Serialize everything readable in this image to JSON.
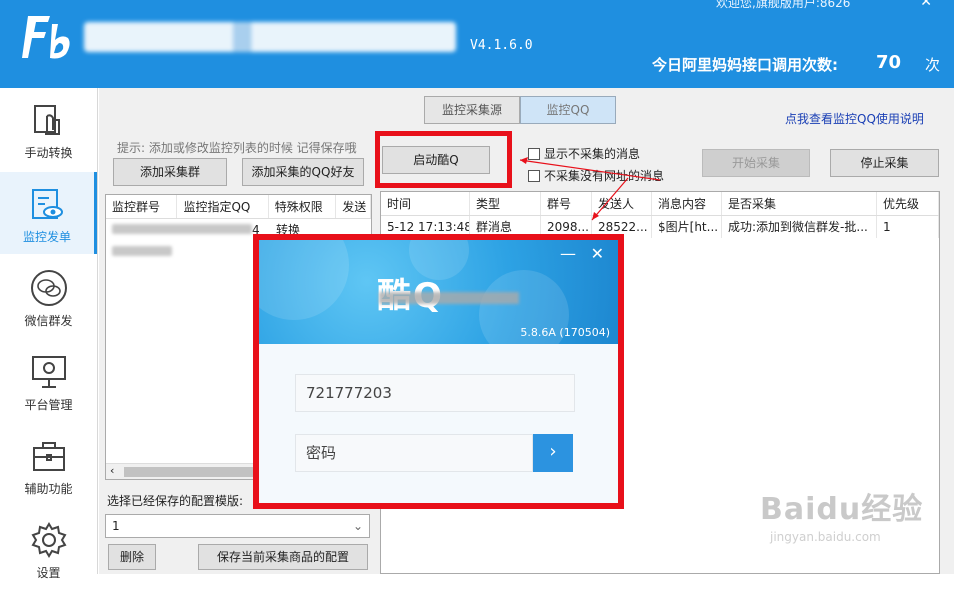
{
  "header": {
    "welcome": "欢迎您,旗舰版用户:8626",
    "close": "✕",
    "version": "V4.1.6.0",
    "api_label": "今日阿里妈妈接口调用次数:",
    "api_count": "70",
    "api_unit": "次"
  },
  "sidebar": {
    "items": [
      {
        "label": "手动转换",
        "icon": "hand-convert-icon"
      },
      {
        "label": "监控发单",
        "icon": "monitor-icon"
      },
      {
        "label": "微信群发",
        "icon": "wechat-icon"
      },
      {
        "label": "平台管理",
        "icon": "platform-icon"
      },
      {
        "label": "辅助功能",
        "icon": "toolbox-icon"
      },
      {
        "label": "设置",
        "icon": "gear-icon"
      }
    ]
  },
  "tabs": [
    "监控采集源",
    "监控QQ"
  ],
  "help_link": "点我查看监控QQ使用说明",
  "left_panel": {
    "hint": "提示: 添加或修改监控列表的时候 记得保存哦",
    "add_group_btn": "添加采集群",
    "add_friend_btn": "添加采集的QQ好友",
    "columns": [
      "监控群号",
      "监控指定QQ",
      "特殊权限",
      "发送"
    ],
    "rows": [
      {
        "col3": "转换",
        "tail": "4"
      }
    ],
    "save_label": "选择已经保存的配置模版:",
    "selected_template": "1",
    "delete_btn": "删除",
    "save_config_btn": "保存当前采集商品的配置"
  },
  "controls": {
    "launch_btn": "启动酷Q",
    "show_uncollected": "显示不采集的消息",
    "no_url": "不采集没有网址的消息",
    "start_btn": "开始采集",
    "stop_btn": "停止采集"
  },
  "right_grid": {
    "columns": [
      "时间",
      "类型",
      "群号",
      "发送人",
      "消息内容",
      "是否采集",
      "优先级"
    ],
    "rows": [
      [
        "5-12 17:13:48",
        "群消息",
        "2098...",
        "28522...",
        "$图片[ht...",
        "成功:添加到微信群发-批...",
        "1"
      ]
    ]
  },
  "login": {
    "minimize": "—",
    "close": "✕",
    "brand": "酷Q",
    "version": "5.8.6A (170504)",
    "account": "721777203",
    "password_placeholder": "密码",
    "go": "›"
  },
  "watermark": {
    "main": "Baidu经验",
    "sub": "jingyan.baidu.com"
  },
  "colors": {
    "header": "#1f8fe0",
    "highlight": "#e8101a",
    "link": "#1a3fb5"
  }
}
